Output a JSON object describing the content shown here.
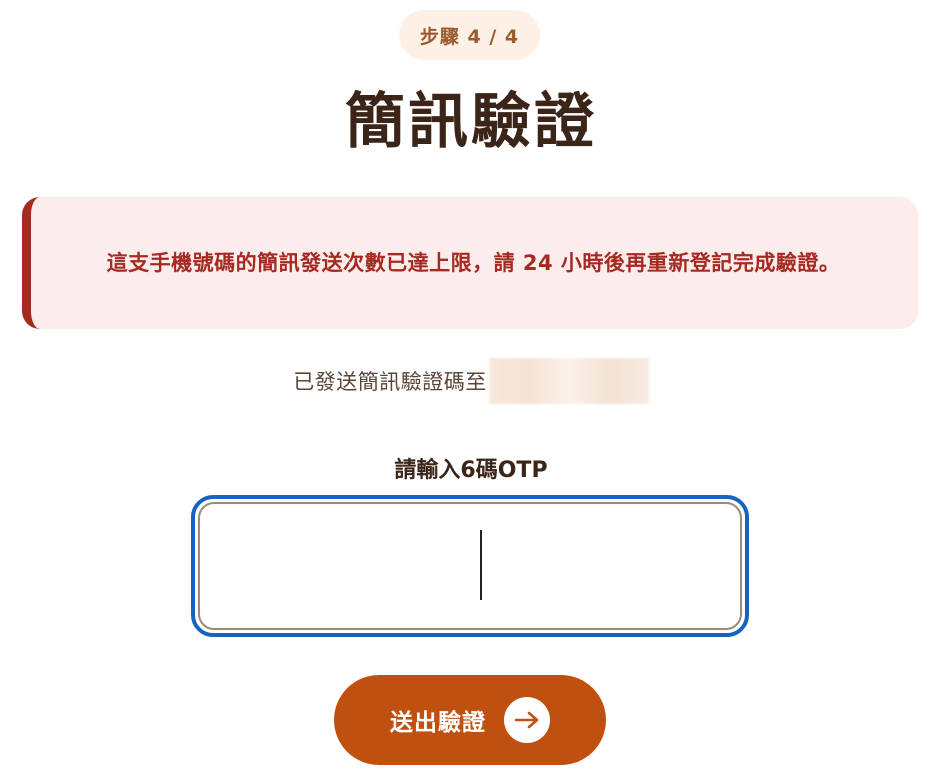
{
  "step": {
    "label": "步驟 4 / 4"
  },
  "title": "簡訊驗證",
  "alert": {
    "message": "這支手機號碼的簡訊發送次數已達上限，請 24 小時後再重新登記完成驗證。"
  },
  "sent_notice": {
    "text": "已發送簡訊驗證碼至"
  },
  "otp": {
    "label": "請輸入6碼OTP",
    "value": ""
  },
  "submit": {
    "label": "送出驗證"
  },
  "colors": {
    "brand": "#c0500f",
    "alert_text": "#a52a22",
    "alert_bg": "#fcecec",
    "focus_ring": "#1565c0",
    "title": "#3b2418"
  },
  "icons": {
    "submit_icon": "arrow-right-icon"
  }
}
